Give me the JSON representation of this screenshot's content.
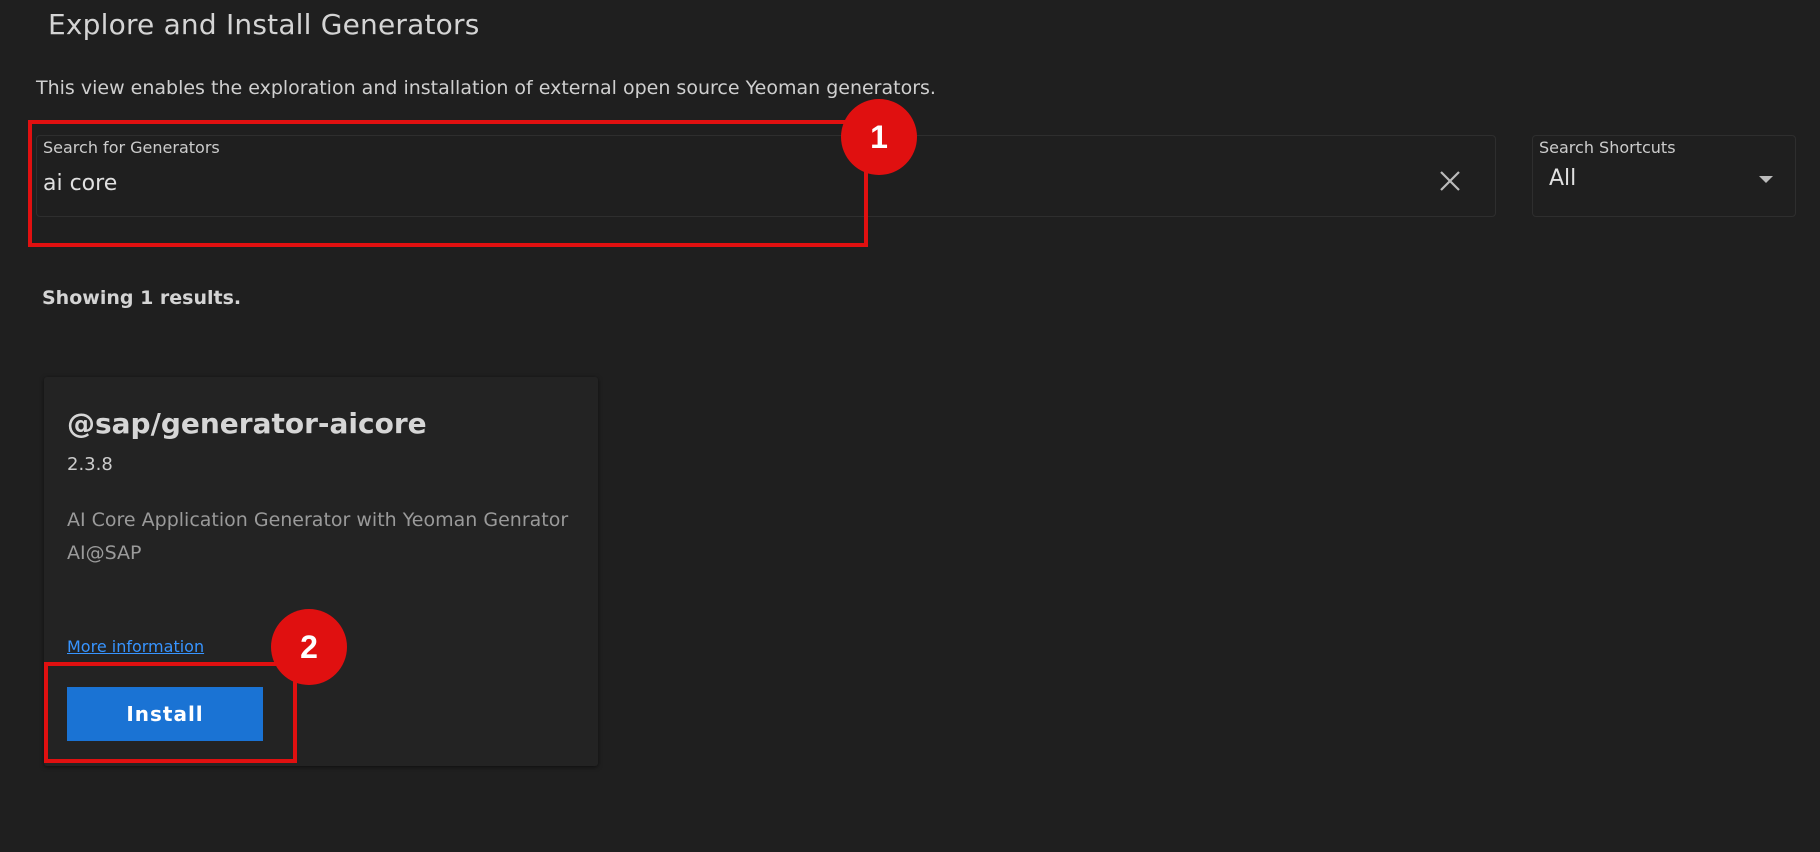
{
  "header": {
    "title": "Explore and Install Generators",
    "description": "This view enables the exploration and installation of external open source Yeoman generators."
  },
  "search": {
    "label": "Search for Generators",
    "value": "ai core",
    "clear_icon": "close-icon"
  },
  "shortcuts": {
    "label": "Search Shortcuts",
    "selected": "All",
    "icon": "caret-down-icon"
  },
  "results": {
    "summary": "Showing 1 results."
  },
  "generator_card": {
    "name": "@sap/generator-aicore",
    "version": "2.3.8",
    "description": "AI Core Application Generator with Yeoman Genrator AI@SAP",
    "more_info_label": "More information",
    "install_label": "Install"
  },
  "annotations": {
    "callout_1": "1",
    "callout_2": "2",
    "highlight_color": "#e01010"
  },
  "colors": {
    "background": "#1f1f1f",
    "card_background": "#232323",
    "accent_button": "#1a73d4",
    "link": "#3794ff"
  }
}
